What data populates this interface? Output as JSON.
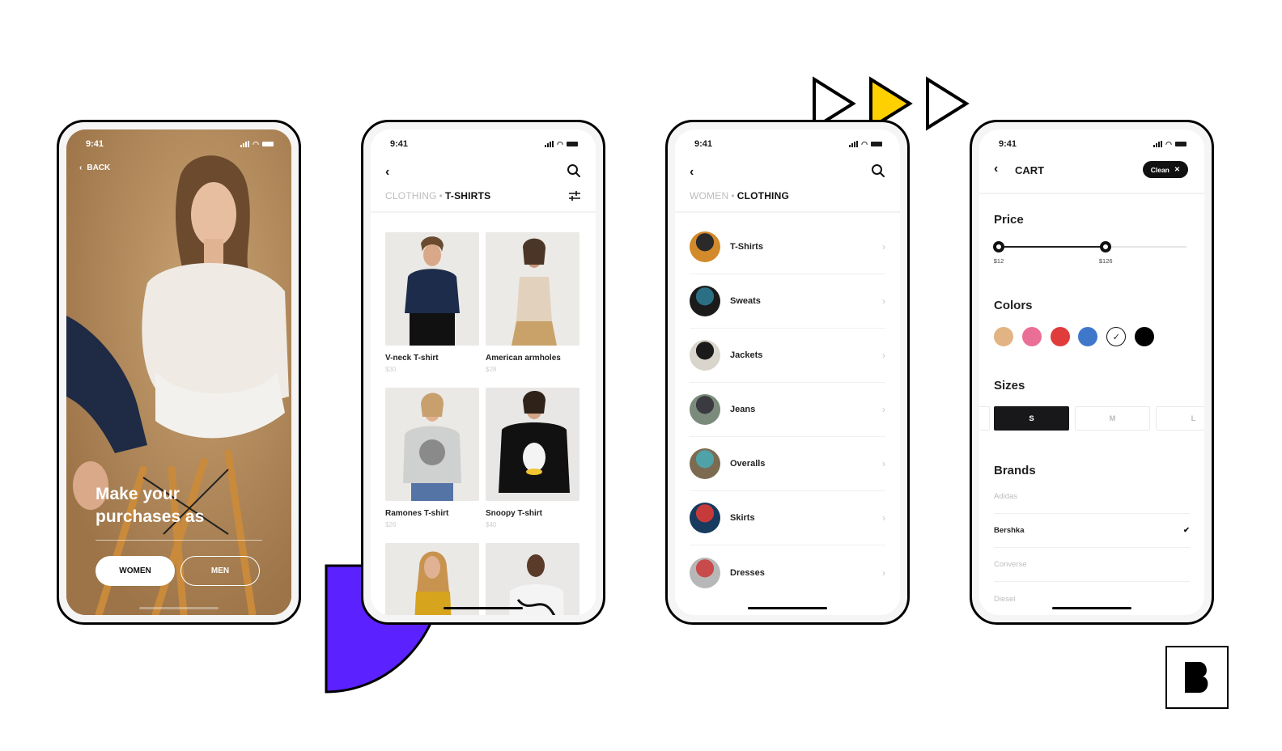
{
  "status_time": "9:41",
  "screens": {
    "welcome": {
      "back_label": "BACK",
      "headline": "Make your purchases as",
      "buttons": {
        "women": "WOMEN",
        "men": "MEN"
      }
    },
    "tshirts": {
      "breadcrumb": {
        "parent": "CLOTHING",
        "separator": "•",
        "current": "T-SHIRTS"
      },
      "products": [
        {
          "name": "V-neck T-shirt",
          "price": "$30"
        },
        {
          "name": "American armholes",
          "price": "$28"
        },
        {
          "name": "Ramones T-shirt",
          "price": "$26"
        },
        {
          "name": "Snoopy T-shirt",
          "price": "$40"
        },
        {
          "name": "",
          "price": ""
        },
        {
          "name": "",
          "price": ""
        }
      ]
    },
    "clothing": {
      "breadcrumb": {
        "parent": "WOMEN",
        "separator": "•",
        "current": "CLOTHING"
      },
      "categories": [
        {
          "label": "T-Shirts"
        },
        {
          "label": "Sweats"
        },
        {
          "label": "Jackets"
        },
        {
          "label": "Jeans"
        },
        {
          "label": "Overalls"
        },
        {
          "label": "Skirts"
        },
        {
          "label": "Dresses"
        }
      ]
    },
    "filters": {
      "title": "CART",
      "clean_label": "Clean",
      "price": {
        "title": "Price",
        "min_label": "$12",
        "max_label": "$126",
        "min_value": 12,
        "max_value": 126,
        "range_fraction_selected": 0.57
      },
      "colors": {
        "title": "Colors",
        "swatches": [
          {
            "name": "tan",
            "hex": "#e2b383",
            "selected": false
          },
          {
            "name": "pink",
            "hex": "#ea6f97",
            "selected": false
          },
          {
            "name": "red",
            "hex": "#e03c3c",
            "selected": false
          },
          {
            "name": "blue",
            "hex": "#3f78cb",
            "selected": false
          },
          {
            "name": "white",
            "hex": "#ffffff",
            "selected": true
          },
          {
            "name": "black",
            "hex": "#000000",
            "selected": false
          }
        ]
      },
      "sizes": {
        "title": "Sizes",
        "options": [
          "S",
          "M",
          "L"
        ],
        "selected": "S"
      },
      "brands": {
        "title": "Brands",
        "items": [
          {
            "label": "Adidas",
            "selected": false
          },
          {
            "label": "Bershka",
            "selected": true
          },
          {
            "label": "Converse",
            "selected": false
          },
          {
            "label": "Diesel",
            "selected": false
          }
        ]
      }
    }
  },
  "decor": {
    "accent_purple": "#5b21ff",
    "accent_yellow": "#ffd000",
    "logo_letter": "B"
  }
}
